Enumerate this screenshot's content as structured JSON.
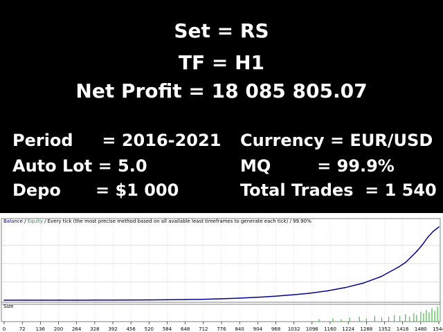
{
  "header": {
    "set_line": "Set = RS",
    "tf_line": "TF  = H1",
    "profit_line": "Net Profit = 18 085 805.07"
  },
  "stats": {
    "period": "Period     = 2016-2021",
    "auto_lot": "Auto Lot = 5.0",
    "depo": "Depo      = $1 000",
    "currency": "Currency = EUR/USD",
    "mq": "MQ        = 99.9%",
    "total_trades": "Total Trades  = 1 540"
  },
  "chart_data": {
    "type": "line",
    "legend": {
      "balance": "Balance",
      "sep1": " / ",
      "equity": "Equity",
      "rest": " / Every tick (the most precise method based on all available least timeframes to generate each tick) / 99.90%"
    },
    "size_label": "Size",
    "x_ticks": [
      "0",
      "72",
      "136",
      "200",
      "264",
      "328",
      "392",
      "456",
      "520",
      "584",
      "648",
      "712",
      "776",
      "840",
      "904",
      "968",
      "1032",
      "1096",
      "1160",
      "1224",
      "1288",
      "1352",
      "1416",
      "1480",
      "1544"
    ],
    "x_range": [
      0,
      1560
    ],
    "y_range": [
      0,
      18100000
    ],
    "grid": true,
    "colors": {
      "balance": "#00008b",
      "equity": "#2e8b57",
      "size": "#32cd32",
      "grid": "#c0c0c0",
      "text": "#000000"
    },
    "series": [
      {
        "name": "Balance",
        "x": [
          0,
          72,
          136,
          200,
          264,
          328,
          392,
          456,
          520,
          584,
          648,
          712,
          776,
          840,
          904,
          968,
          1032,
          1096,
          1160,
          1224,
          1288,
          1352,
          1416,
          1440,
          1460,
          1480,
          1500,
          1520,
          1540,
          1560
        ],
        "values": [
          1000,
          2000,
          3500,
          5000,
          8000,
          12000,
          20000,
          35000,
          60000,
          100000,
          150000,
          220000,
          350000,
          500000,
          700000,
          950000,
          1300000,
          1700000,
          2300000,
          3100000,
          4200000,
          5800000,
          8200000,
          9300000,
          10600000,
          12000000,
          13600000,
          15500000,
          17000000,
          18085805
        ]
      }
    ],
    "size_bars": {
      "x": [
        1130,
        1180,
        1210,
        1240,
        1275,
        1300,
        1330,
        1355,
        1380,
        1400,
        1420,
        1440,
        1455,
        1470,
        1480,
        1495,
        1505,
        1515,
        1525,
        1535,
        1545,
        1555
      ],
      "values": [
        0.15,
        0.2,
        0.15,
        0.25,
        0.3,
        0.2,
        0.35,
        0.25,
        0.3,
        0.4,
        0.35,
        0.45,
        0.3,
        0.5,
        0.4,
        0.6,
        0.5,
        0.7,
        0.55,
        0.8,
        0.65,
        0.9
      ]
    }
  }
}
